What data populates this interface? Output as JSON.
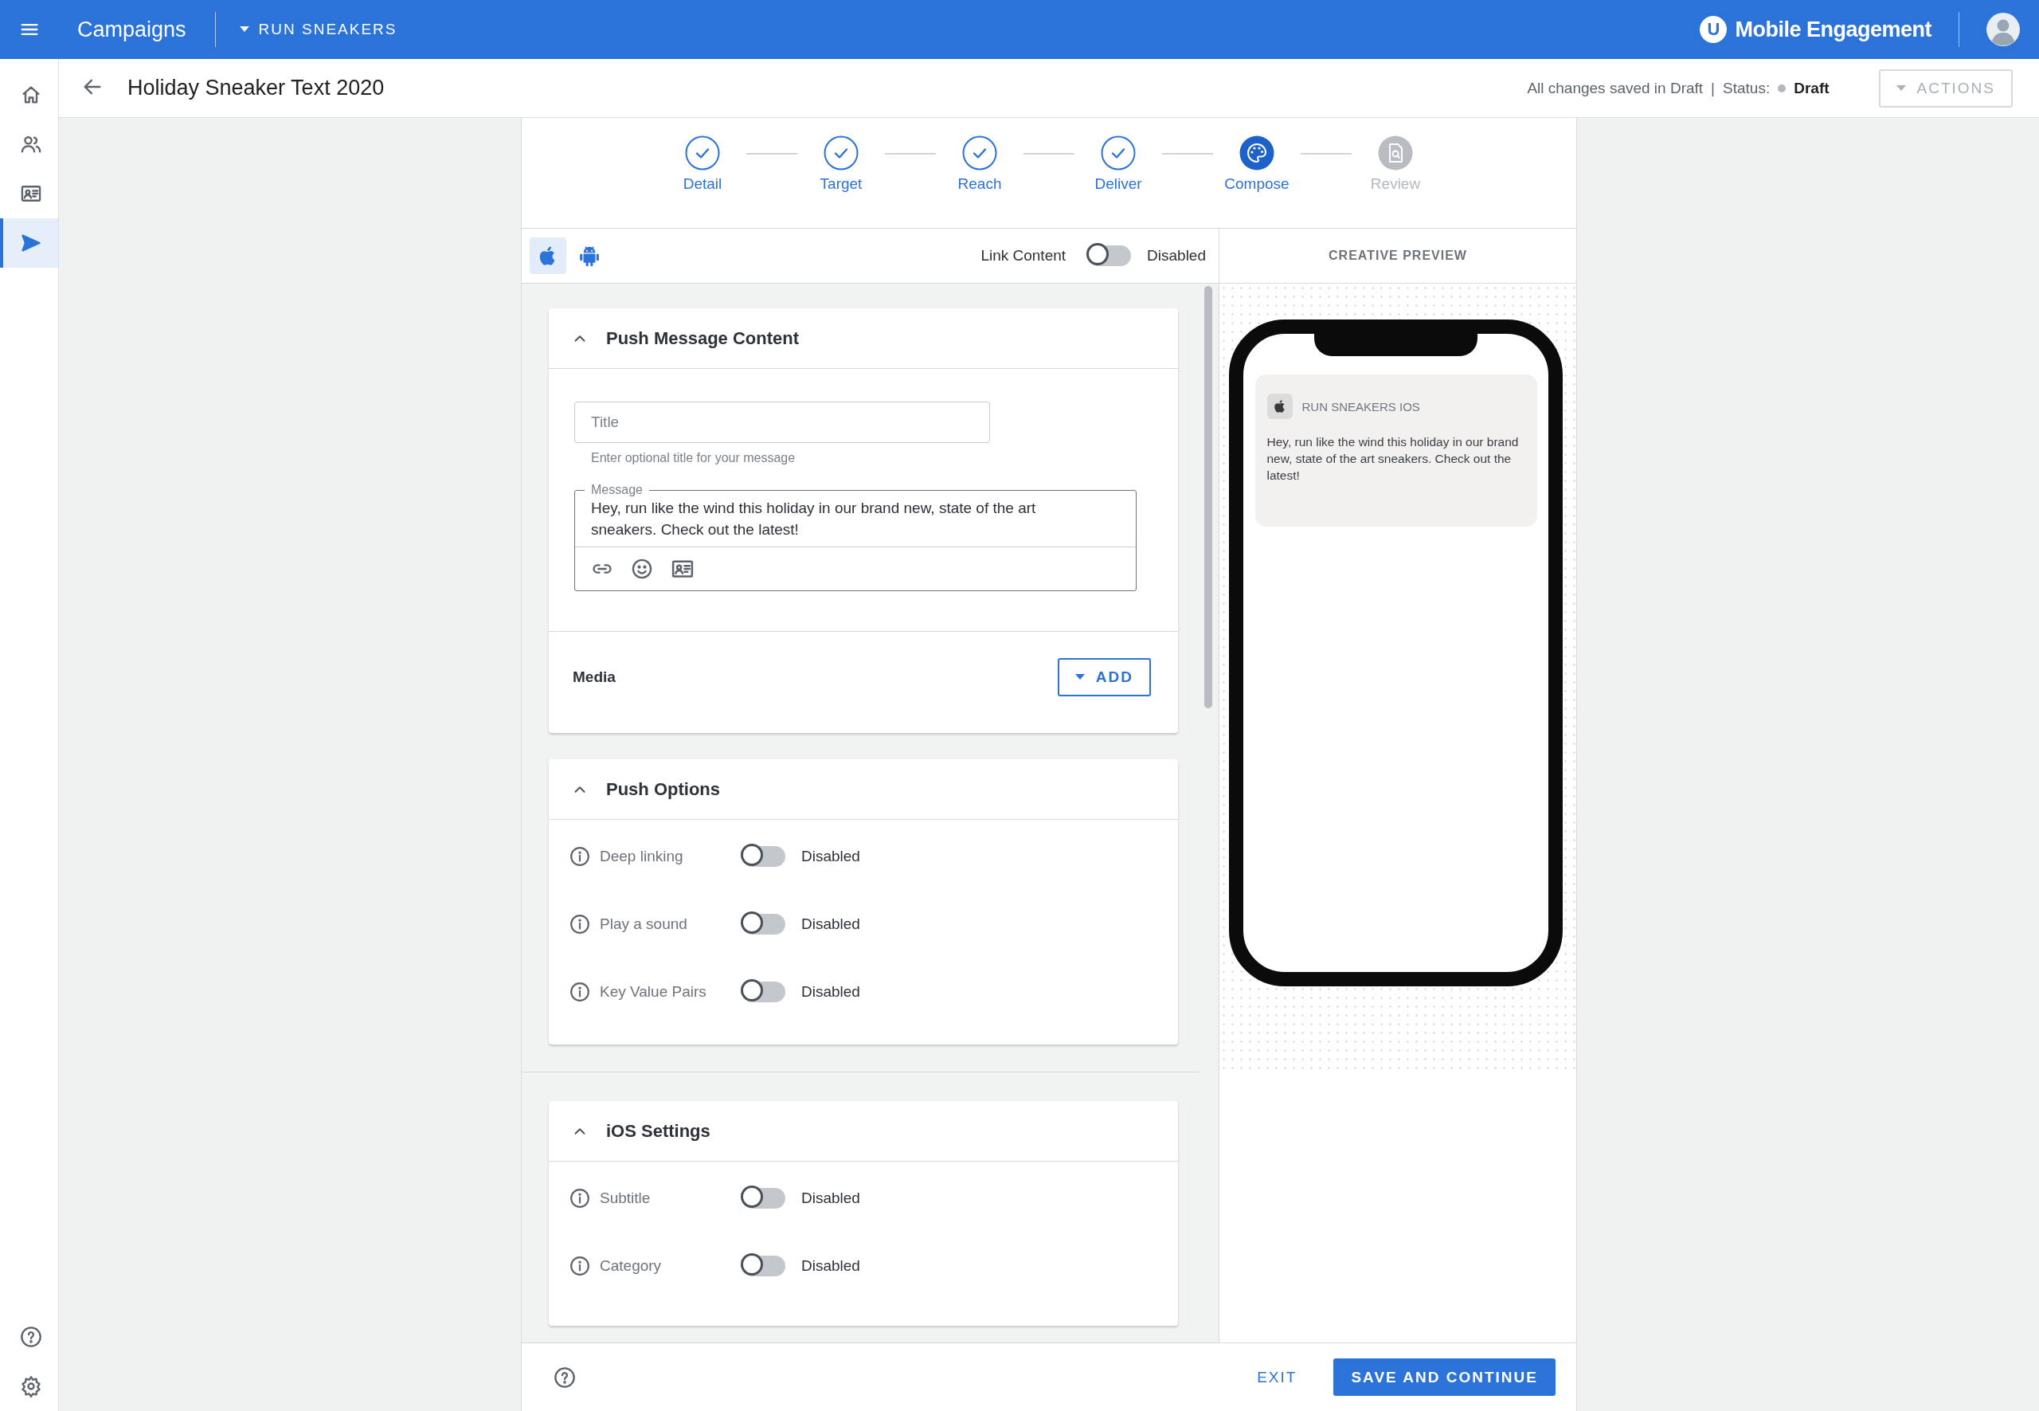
{
  "app_bar": {
    "title": "Campaigns",
    "app": "RUN SNEAKERS",
    "brand": {
      "mark": "U",
      "name": "Mobile Engagement"
    }
  },
  "sidebar": {
    "items": [
      {
        "selected": false
      },
      {
        "selected": false
      },
      {
        "selected": false
      },
      {
        "selected": true
      }
    ]
  },
  "header": {
    "title": "Holiday Sneaker Text 2020",
    "save_state": "All changes saved in Draft",
    "separator": "|",
    "status_label": "Status:",
    "status": "Draft",
    "actions": {
      "label": "ACTIONS",
      "disabled": true
    }
  },
  "stepper": [
    {
      "label": "Detail",
      "kind": "done"
    },
    {
      "label": "Target",
      "kind": "done"
    },
    {
      "label": "Reach",
      "kind": "done"
    },
    {
      "label": "Deliver",
      "kind": "done"
    },
    {
      "label": "Compose",
      "kind": "current"
    },
    {
      "label": "Review",
      "kind": "pending"
    }
  ],
  "platforms": [
    {
      "selected": true
    },
    {
      "selected": false
    }
  ],
  "link_content": {
    "label": "Link Content",
    "on": false,
    "state": "Disabled"
  },
  "sections": [
    {
      "kind": "content",
      "title": "Push Message Content",
      "expanded": true,
      "title_field": {
        "placeholder": "Title"
      },
      "helper": "Enter optional title for your message",
      "message": {
        "label": "Message",
        "value": "Hey, run like the wind this holiday in our brand new, state of the art sneakers. Check out the latest!"
      },
      "media": {
        "label": "Media",
        "button": "ADD"
      }
    },
    {
      "kind": "options",
      "title": "Push Options",
      "expanded": true,
      "rows": [
        {
          "label": "Deep linking",
          "on": false,
          "state": "Disabled"
        },
        {
          "label": "Play a sound",
          "on": false,
          "state": "Disabled"
        },
        {
          "label": "Key Value Pairs",
          "on": false,
          "state": "Disabled"
        }
      ]
    },
    {
      "kind": "options",
      "title": "iOS Settings",
      "expanded": true,
      "rows": [
        {
          "label": "Subtitle",
          "on": false,
          "state": "Disabled"
        },
        {
          "label": "Category",
          "on": false,
          "state": "Disabled"
        }
      ]
    }
  ],
  "preview": {
    "title": "CREATIVE PREVIEW",
    "notification": {
      "app": "RUN SNEAKERS IOS",
      "message": "Hey, run like the wind this holiday in our brand new, state of the art sneakers. Check out the latest!"
    }
  },
  "footer": {
    "exit": "EXIT",
    "save": "SAVE AND CONTINUE"
  }
}
